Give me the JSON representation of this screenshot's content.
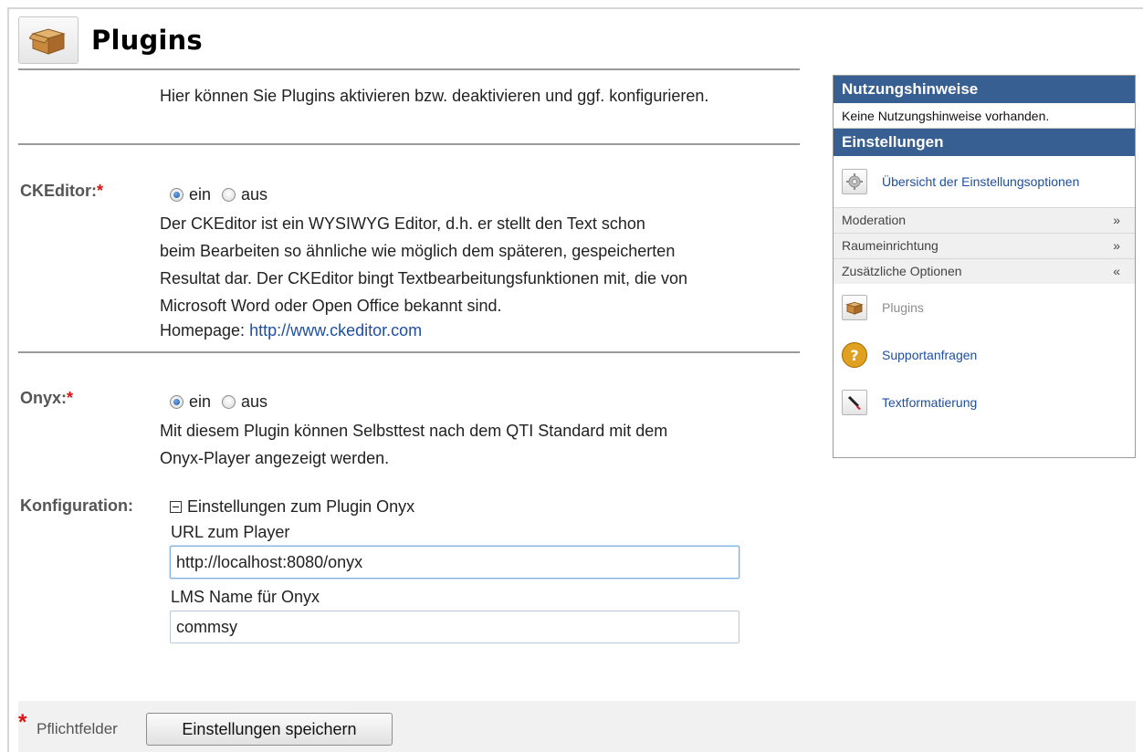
{
  "header": {
    "title": "Plugins",
    "icon": "package-box-icon"
  },
  "intro": {
    "text": "Hier können Sie Plugins aktivieren bzw. deaktivieren und ggf. konfigurieren."
  },
  "required_mark": "*",
  "ckeditor": {
    "label": "CKEditor:",
    "option_on": "ein",
    "option_off": "aus",
    "selected": "ein",
    "description_lines": [
      "Der CKEditor ist ein WYSIWYG Editor, d.h. er stellt den Text schon",
      "beim Bearbeiten so ähnliche wie möglich dem späteren, gespeicherten",
      "Resultat dar. Der CKEditor bingt Textbearbeitungsfunktionen mit, die von",
      "Microsoft Word oder Open Office bekannt sind."
    ],
    "homepage_label": "Homepage:",
    "homepage_url": "http://www.ckeditor.com"
  },
  "onyx": {
    "label": "Onyx:",
    "option_on": "ein",
    "option_off": "aus",
    "selected": "ein",
    "description_lines": [
      "Mit diesem Plugin können Selbsttest nach dem QTI Standard mit dem",
      "Onyx-Player angezeigt werden."
    ]
  },
  "configuration": {
    "label": "Konfiguration:",
    "toggle_text": "Einstellungen zum Plugin Onyx",
    "url_label": "URL zum Player",
    "url_value": "http://localhost:8080/onyx",
    "lms_label": "LMS Name für Onyx",
    "lms_value": "commsy"
  },
  "footer": {
    "required_text": "Pflichtfelder",
    "save_button": "Einstellungen speichern"
  },
  "sidebar": {
    "usage_header": "Nutzungshinweise",
    "usage_note": "Keine Nutzungshinweise vorhanden.",
    "settings_header": "Einstellungen",
    "overview_link": "Übersicht der Einstellungsoptionen",
    "sections": [
      {
        "label": "Moderation",
        "state": "collapsed"
      },
      {
        "label": "Raumeinrichtung",
        "state": "collapsed"
      },
      {
        "label": "Zusätzliche Optionen",
        "state": "expanded"
      }
    ],
    "sub_items": [
      {
        "label": "Plugins",
        "icon": "package-box-icon"
      },
      {
        "label": "Supportanfragen",
        "icon": "question-icon"
      },
      {
        "label": "Textformatierung",
        "icon": "brush-icon"
      }
    ]
  },
  "colors": {
    "sidebar_header_bg": "#385f91",
    "link": "#1f4fa0",
    "required": "#dd1111"
  }
}
